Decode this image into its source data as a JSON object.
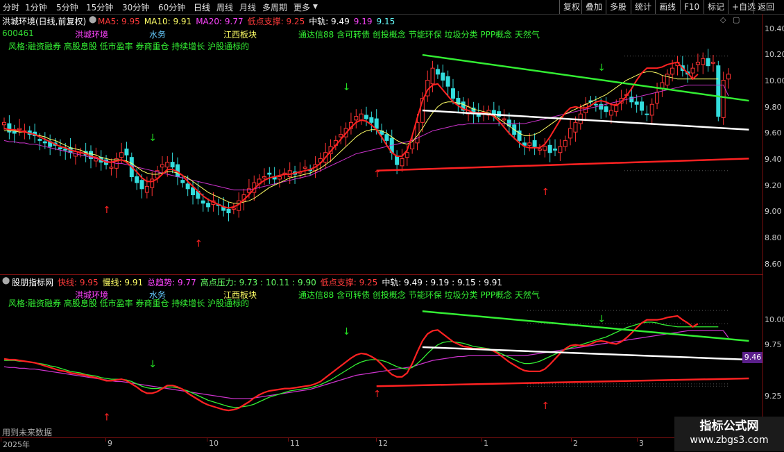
{
  "toolbar": {
    "periods": [
      "分时",
      "1分钟",
      "5分钟",
      "15分钟",
      "30分钟",
      "60分钟",
      "日线",
      "周线",
      "月线",
      "多周期",
      "更多"
    ],
    "active_period": "日线",
    "buttons": [
      "复权",
      "叠加",
      "多股",
      "统计",
      "画线",
      "F10",
      "标记",
      "+自选",
      "返回"
    ]
  },
  "main_panel": {
    "title": "洪城环境(日线,前复权)",
    "indicators": [
      {
        "label": "MA5: 9.95",
        "color": "#ff3b3b"
      },
      {
        "label": "MA10: 9.91",
        "color": "#ffff66"
      },
      {
        "label": "MA20: 9.77",
        "color": "#ff44ff"
      },
      {
        "label": "低点支撑: 9.25",
        "color": "#ff3b3b"
      },
      {
        "label": "中轨: 9.49",
        "color": "#ffffff"
      },
      {
        "label": "9.19",
        "color": "#ff44ff"
      },
      {
        "label": "9.15",
        "color": "#66ffff"
      }
    ],
    "stock_code": "600461",
    "name_tag": "洪城环境",
    "industry_tag": "水务",
    "region_tag": "江西板块",
    "concepts": "通达信88 含可转债 创投概念 节能环保 垃圾分类 PPP概念 天然气",
    "style": "风格:融资融券 高股息股 低市盈率 券商重仓 持续增长 沪股通标的",
    "y_ticks": [
      "10.40",
      "10.20",
      "10.00",
      "9.80",
      "9.60",
      "9.40",
      "9.20",
      "9.00",
      "8.80",
      "8.60"
    ]
  },
  "sub_panel": {
    "title": "股朋指标网",
    "indicators": [
      {
        "label": "快线: 9.95",
        "color": "#ff3b3b"
      },
      {
        "label": "慢线: 9.91",
        "color": "#ffff66"
      },
      {
        "label": "总趋势: 9.77",
        "color": "#ff44ff"
      },
      {
        "label": "高点压力: 9.73 : 10.11 : 9.90",
        "color": "#66ff66"
      },
      {
        "label": "低点支撑: 9.25",
        "color": "#ff3b3b"
      },
      {
        "label": "中轨: 9.49 : 9.19 : 9.15 : 9.91",
        "color": "#ffffff"
      }
    ],
    "name_tag": "洪城环境",
    "industry_tag": "水务",
    "region_tag": "江西板块",
    "concepts": "通达信88 含可转债 创投概念 节能环保 垃圾分类 PPP概念 天然气",
    "style": "风格:融资融券 高股息股 低市盈率 券商重仓 持续增长 沪股通标的",
    "y_ticks": [
      "10.00",
      "9.75",
      "9.25",
      "9.00"
    ],
    "current_value": "9.46",
    "footer_note": "用到未来数据"
  },
  "x_axis": {
    "labels": [
      "2025年",
      "9",
      "10",
      "11",
      "12",
      "1",
      "2",
      "3"
    ]
  },
  "logo": {
    "line1": "指标公式网",
    "line2": "www.zbgs3.com"
  },
  "chart_data": {
    "type": "candlestick",
    "ylim": [
      8.55,
      10.45
    ],
    "closes": [
      9.55,
      9.47,
      9.46,
      9.5,
      9.48,
      9.45,
      9.44,
      9.4,
      9.38,
      9.35,
      9.36,
      9.33,
      9.32,
      9.3,
      9.31,
      9.3,
      9.28,
      9.25,
      9.26,
      9.22,
      9.2,
      9.18,
      9.25,
      9.3,
      9.28,
      9.1,
      9.05,
      9.0,
      9.02,
      9.08,
      9.15,
      9.2,
      9.22,
      9.18,
      9.1,
      9.05,
      9.0,
      8.95,
      8.92,
      8.88,
      8.85,
      8.9,
      8.86,
      8.82,
      8.8,
      8.84,
      8.9,
      8.95,
      9.0,
      9.05,
      9.08,
      9.1,
      9.12,
      9.08,
      9.1,
      9.13,
      9.15,
      9.12,
      9.14,
      9.18,
      9.15,
      9.2,
      9.25,
      9.3,
      9.35,
      9.4,
      9.45,
      9.5,
      9.55,
      9.6,
      9.62,
      9.58,
      9.55,
      9.5,
      9.45,
      9.4,
      9.3,
      9.2,
      9.25,
      9.3,
      9.4,
      9.55,
      9.75,
      9.9,
      10.0,
      9.95,
      9.9,
      9.85,
      9.75,
      9.7,
      9.65,
      9.68,
      9.62,
      9.6,
      9.63,
      9.65,
      9.62,
      9.6,
      9.58,
      9.52,
      9.45,
      9.4,
      9.36,
      9.38,
      9.35,
      9.33,
      9.35,
      9.3,
      9.32,
      9.35,
      9.4,
      9.5,
      9.55,
      9.62,
      9.7,
      9.72,
      9.7,
      9.66,
      9.64,
      9.65,
      9.7,
      9.75,
      9.78,
      9.72,
      9.7,
      9.65,
      9.62,
      9.7,
      9.8,
      9.88,
      9.95,
      10.0,
      10.05,
      9.98,
      9.95,
      10.0,
      10.05,
      10.08,
      10.02,
      10.05,
      9.6,
      9.9,
      9.95
    ],
    "ma5": [
      9.5,
      9.49,
      9.49,
      9.48,
      9.47,
      9.46,
      9.45,
      9.43,
      9.41,
      9.39,
      9.37,
      9.35,
      9.34,
      9.32,
      9.31,
      9.3,
      9.29,
      9.27,
      9.26,
      9.24,
      9.22,
      9.22,
      9.23,
      9.24,
      9.22,
      9.18,
      9.14,
      9.09,
      9.06,
      9.06,
      9.08,
      9.12,
      9.16,
      9.16,
      9.14,
      9.11,
      9.06,
      9.02,
      8.98,
      8.94,
      8.91,
      8.89,
      8.87,
      8.85,
      8.84,
      8.85,
      8.87,
      8.91,
      8.95,
      9.0,
      9.04,
      9.07,
      9.09,
      9.1,
      9.11,
      9.12,
      9.12,
      9.13,
      9.14,
      9.15,
      9.16,
      9.18,
      9.21,
      9.26,
      9.31,
      9.36,
      9.41,
      9.46,
      9.51,
      9.55,
      9.57,
      9.56,
      9.53,
      9.49,
      9.43,
      9.36,
      9.3,
      9.27,
      9.27,
      9.32,
      9.44,
      9.59,
      9.73,
      9.82,
      9.86,
      9.87,
      9.82,
      9.77,
      9.72,
      9.69,
      9.66,
      9.65,
      9.63,
      9.63,
      9.63,
      9.62,
      9.6,
      9.56,
      9.51,
      9.46,
      9.42,
      9.38,
      9.35,
      9.34,
      9.34,
      9.34,
      9.37,
      9.43,
      9.5,
      9.57,
      9.63,
      9.67,
      9.68,
      9.67,
      9.67,
      9.69,
      9.72,
      9.73,
      9.72,
      9.7,
      9.69,
      9.72,
      9.77,
      9.83,
      9.9,
      9.96,
      10.0,
      10.0,
      10.0,
      10.01,
      10.03,
      10.04,
      10.05,
      10.0,
      9.96,
      9.91,
      9.95
    ],
    "ma10": [
      9.48,
      9.48,
      9.48,
      9.47,
      9.47,
      9.46,
      9.45,
      9.44,
      9.43,
      9.41,
      9.4,
      9.38,
      9.36,
      9.34,
      9.33,
      9.32,
      9.3,
      9.29,
      9.28,
      9.26,
      9.25,
      9.24,
      9.24,
      9.24,
      9.23,
      9.21,
      9.18,
      9.15,
      9.13,
      9.12,
      9.12,
      9.13,
      9.14,
      9.14,
      9.13,
      9.11,
      9.09,
      9.06,
      9.03,
      9.0,
      8.97,
      8.95,
      8.93,
      8.91,
      8.89,
      8.88,
      8.88,
      8.89,
      8.9,
      8.92,
      8.95,
      8.98,
      9.01,
      9.03,
      9.05,
      9.07,
      9.09,
      9.1,
      9.11,
      9.12,
      9.13,
      9.15,
      9.17,
      9.2,
      9.23,
      9.27,
      9.31,
      9.35,
      9.39,
      9.43,
      9.46,
      9.48,
      9.49,
      9.49,
      9.48,
      9.46,
      9.43,
      9.4,
      9.38,
      9.37,
      9.39,
      9.44,
      9.5,
      9.57,
      9.63,
      9.68,
      9.71,
      9.72,
      9.72,
      9.71,
      9.7,
      9.68,
      9.66,
      9.65,
      9.64,
      9.63,
      9.61,
      9.58,
      9.55,
      9.52,
      9.49,
      9.46,
      9.44,
      9.44,
      9.45,
      9.47,
      9.5,
      9.53,
      9.56,
      9.59,
      9.62,
      9.64,
      9.66,
      9.68,
      9.7,
      9.72,
      9.74,
      9.76,
      9.78,
      9.81,
      9.84,
      9.87,
      9.9,
      9.92,
      9.94,
      9.96,
      9.97,
      9.97,
      9.96,
      9.94,
      9.93,
      9.92,
      9.91,
      9.91,
      9.91,
      9.91,
      9.91,
      9.91,
      9.91,
      9.91,
      9.91
    ],
    "ma20": [
      9.4,
      9.39,
      9.39,
      9.38,
      9.38,
      9.37,
      9.37,
      9.36,
      9.35,
      9.34,
      9.33,
      9.32,
      9.31,
      9.3,
      9.29,
      9.28,
      9.27,
      9.26,
      9.25,
      9.24,
      9.23,
      9.22,
      9.21,
      9.21,
      9.2,
      9.19,
      9.18,
      9.17,
      9.16,
      9.15,
      9.14,
      9.13,
      9.12,
      9.11,
      9.1,
      9.09,
      9.08,
      9.07,
      9.06,
      9.05,
      9.04,
      9.03,
      9.02,
      9.01,
      9.0,
      8.99,
      8.99,
      8.99,
      8.99,
      9.0,
      9.01,
      9.02,
      9.03,
      9.04,
      9.05,
      9.06,
      9.07,
      9.08,
      9.09,
      9.1,
      9.11,
      9.13,
      9.15,
      9.17,
      9.19,
      9.21,
      9.23,
      9.25,
      9.27,
      9.29,
      9.3,
      9.31,
      9.32,
      9.33,
      9.34,
      9.35,
      9.36,
      9.37,
      9.38,
      9.39,
      9.4,
      9.42,
      9.44,
      9.46,
      9.48,
      9.49,
      9.5,
      9.51,
      9.52,
      9.53,
      9.53,
      9.54,
      9.54,
      9.54,
      9.54,
      9.54,
      9.54,
      9.54,
      9.54,
      9.54,
      9.54,
      9.54,
      9.54,
      9.55,
      9.56,
      9.57,
      9.58,
      9.59,
      9.6,
      9.61,
      9.62,
      9.63,
      9.64,
      9.65,
      9.66,
      9.67,
      9.68,
      9.69,
      9.7,
      9.71,
      9.72,
      9.73,
      9.74,
      9.75,
      9.76,
      9.77,
      9.78,
      9.79,
      9.8,
      9.81,
      9.82,
      9.83,
      9.84,
      9.85,
      9.86,
      9.86,
      9.86,
      9.86,
      9.86,
      9.86,
      9.86,
      9.86,
      9.77
    ],
    "trendlines": [
      {
        "name": "高点压力",
        "color": "#33ee33",
        "from": [
          82,
          10.11
        ],
        "to": [
          146,
          9.73
        ]
      },
      {
        "name": "中轨",
        "color": "#ffffff",
        "from": [
          82,
          9.65
        ],
        "to": [
          146,
          9.49
        ]
      },
      {
        "name": "低点支撑",
        "color": "#ff2222",
        "from": [
          73,
          9.15
        ],
        "to": [
          146,
          9.25
        ]
      }
    ],
    "buy_arrows": [
      20,
      38,
      73,
      106
    ],
    "sell_arrows": [
      29,
      67,
      117
    ]
  }
}
